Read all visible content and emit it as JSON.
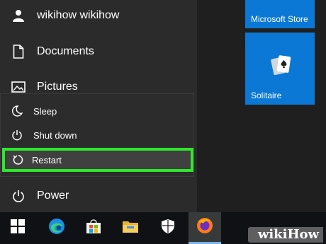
{
  "start_menu": {
    "user": {
      "name": "wikihow wikihow",
      "icon": "user-icon"
    },
    "items": [
      {
        "label": "Documents",
        "icon": "document-icon"
      },
      {
        "label": "Pictures",
        "icon": "pictures-icon"
      }
    ],
    "power_flyout": {
      "items": [
        {
          "label": "Sleep",
          "icon": "moon-icon"
        },
        {
          "label": "Shut down",
          "icon": "power-icon"
        },
        {
          "label": "Restart",
          "icon": "restart-icon",
          "highlighted": true,
          "highlight_color": "#2ee82b"
        }
      ]
    },
    "power": {
      "label": "Power",
      "icon": "power-icon"
    }
  },
  "tiles": [
    {
      "label": "Microsoft Store",
      "color": "#0a78d4"
    },
    {
      "label": "Solitaire",
      "color": "#0a78d4",
      "icon": "solitaire-icon"
    }
  ],
  "taskbar": {
    "buttons": [
      {
        "name": "start",
        "icon": "windows-logo-icon"
      },
      {
        "name": "edge",
        "icon": "edge-icon"
      },
      {
        "name": "store",
        "icon": "store-icon"
      },
      {
        "name": "file-explorer",
        "icon": "folder-icon"
      },
      {
        "name": "security",
        "icon": "shield-icon"
      },
      {
        "name": "firefox",
        "icon": "firefox-icon",
        "active": true
      }
    ]
  },
  "watermark": {
    "brand_prefix": "wiki",
    "brand_suffix": "How"
  }
}
